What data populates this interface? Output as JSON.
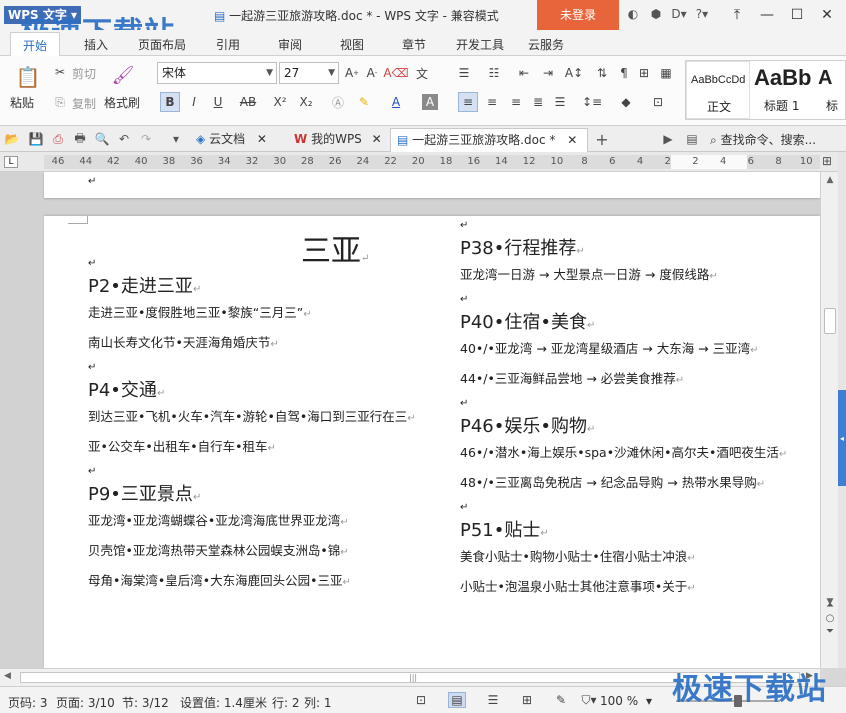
{
  "titlebar": {
    "app_name": "WPS 文字",
    "watermark": "极速下载站",
    "doc_title": "一起游三亚旅游攻略.doc * - WPS 文字 - 兼容模式",
    "login_label": "未登录"
  },
  "menu": {
    "tabs": [
      "开始",
      "插入",
      "页面布局",
      "引用",
      "审阅",
      "视图",
      "章节",
      "开发工具",
      "云服务"
    ]
  },
  "ribbon": {
    "paste": "粘贴",
    "cut": "剪切",
    "copy": "复制",
    "format_painter": "格式刷",
    "font_name": "宋体",
    "font_size": "27",
    "bold": "B",
    "italic": "I",
    "underline": "U",
    "styles": [
      {
        "sample": "AaBbCcDd",
        "name": "正文"
      },
      {
        "sample": "AaBb",
        "name": "标题 1"
      },
      {
        "sample": "A",
        "name": "标"
      }
    ]
  },
  "tabstrip": {
    "tabs": [
      {
        "label": "云文档"
      },
      {
        "label": "我的WPS"
      },
      {
        "label": "一起游三亚旅游攻略.doc *"
      }
    ],
    "search_placeholder": "查找命令、搜索..."
  },
  "ruler": {
    "ticks": [
      "46",
      "44",
      "42",
      "40",
      "38",
      "36",
      "34",
      "32",
      "30",
      "28",
      "26",
      "24",
      "22",
      "20",
      "18",
      "16",
      "14",
      "12",
      "10",
      "8",
      "6",
      "4",
      "2",
      "2",
      "4",
      "6",
      "8",
      "10"
    ]
  },
  "document": {
    "title": "三亚",
    "left": [
      {
        "kind": "heading",
        "text": "P2•走进三亚"
      },
      {
        "kind": "line",
        "text": "走进三亚•度假胜地三亚•黎族“三月三”"
      },
      {
        "kind": "line",
        "text": "南山长寿文化节•天涯海角婚庆节"
      },
      {
        "kind": "heading",
        "text": "P4•交通"
      },
      {
        "kind": "line",
        "text": "到达三亚•飞机•火车•汽车•游轮•自驾•海口到三亚行在三"
      },
      {
        "kind": "line",
        "text": "亚•公交车•出租车•自行车•租车"
      },
      {
        "kind": "heading",
        "text": "P9•三亚景点"
      },
      {
        "kind": "line",
        "text": "亚龙湾•亚龙湾蝴蝶谷•亚龙湾海底世界亚龙湾"
      },
      {
        "kind": "line",
        "text": "贝壳馆•亚龙湾热带天堂森林公园蜈支洲岛•锦"
      },
      {
        "kind": "line",
        "text": "母角•海棠湾•皇后湾•大东海鹿回头公园•三亚"
      }
    ],
    "right": [
      {
        "kind": "heading",
        "text": "P38•行程推荐"
      },
      {
        "kind": "line",
        "text": "亚龙湾一日游 → 大型景点一日游 → 度假线路"
      },
      {
        "kind": "heading",
        "text": "P40•住宿•美食"
      },
      {
        "kind": "line",
        "text": "40•/•亚龙湾 → 亚龙湾星级酒店 → 大东海 → 三亚湾"
      },
      {
        "kind": "line",
        "text": "44•/•三亚海鲜品尝地 → 必尝美食推荐"
      },
      {
        "kind": "heading",
        "text": "P46•娱乐•购物"
      },
      {
        "kind": "line",
        "text": "46•/•潜水•海上娱乐•spa•沙滩休闲•高尔夫•酒吧夜生活"
      },
      {
        "kind": "line",
        "text": "48•/•三亚离岛免税店 → 纪念品导购 → 热带水果导购"
      },
      {
        "kind": "heading",
        "text": "P51•贴士"
      },
      {
        "kind": "line",
        "text": "美食小贴士•购物小贴士•住宿小贴士冲浪"
      },
      {
        "kind": "line",
        "text": "小贴士•泡温泉小贴士其他注意事项•关于"
      }
    ],
    "paragraph_mark": "↵"
  },
  "statusbar": {
    "page_code": "页码: 3",
    "page": "页面: 3/10",
    "section": "节: 3/12",
    "setting": "设置值: 1.4厘米",
    "row": "行: 2",
    "col": "列: 1",
    "zoom": "100 %",
    "zoom_level": 0.6
  },
  "colors": {
    "accent": "#2a6fc4",
    "login": "#e8643b"
  }
}
